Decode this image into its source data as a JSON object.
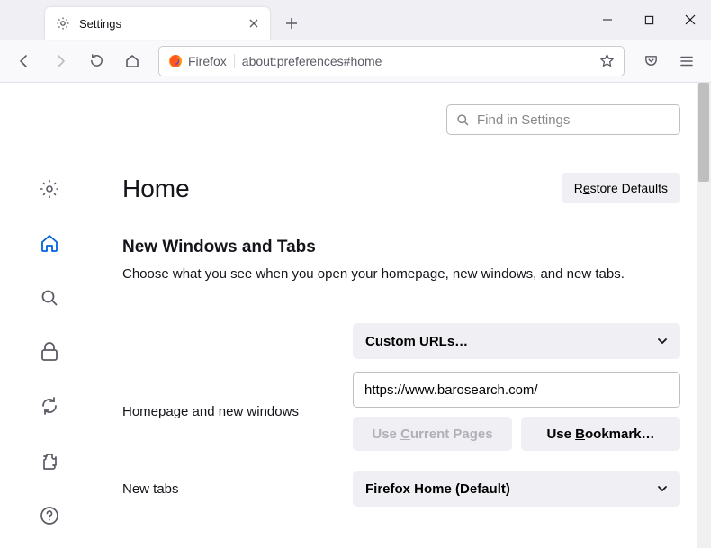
{
  "tab": {
    "title": "Settings"
  },
  "urlbar": {
    "identity": "Firefox",
    "url": "about:preferences#home"
  },
  "search": {
    "placeholder": "Find in Settings"
  },
  "page": {
    "title": "Home"
  },
  "restore": {
    "label_pre": "R",
    "label_u": "e",
    "label_post": "store Defaults"
  },
  "section": {
    "title": "New Windows and Tabs",
    "desc": "Choose what you see when you open your homepage, new windows, and new tabs."
  },
  "homepage": {
    "label": "Homepage and new windows",
    "select_value": "Custom URLs…",
    "url_value": "https://www.barosearch.com/",
    "use_current_pre": "Use ",
    "use_current_u": "C",
    "use_current_post": "urrent Pages",
    "use_bookmark_pre": "Use ",
    "use_bookmark_u": "B",
    "use_bookmark_post": "ookmark…"
  },
  "newtabs": {
    "label": "New tabs",
    "select_value": "Firefox Home (Default)"
  }
}
